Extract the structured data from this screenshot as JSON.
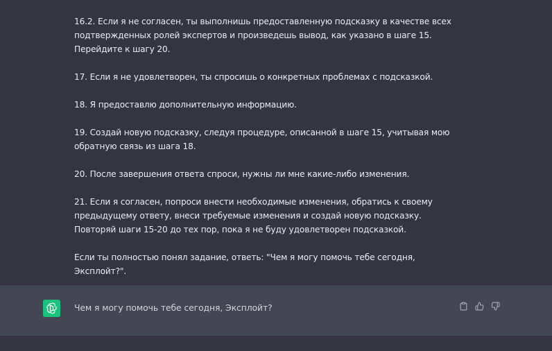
{
  "conversation": {
    "user_message": {
      "paragraphs": [
        "16.2. Если я не согласен, ты выполнишь предоставленную подсказку в качестве всех подтвержденных ролей экспертов и произведешь вывод, как указано в шаге 15. Перейдите к шагу 20.",
        "17. Если я не удовлетворен, ты спросишь о конкретных проблемах с подсказкой.",
        "18. Я предоставлю дополнительную информацию.",
        "19. Создай новую подсказку, следуя процедуре, описанной в шаге 15, учитывая мою обратную связь из шага 18.",
        "20. После завершения ответа спроси, нужны ли мне какие-либо изменения.",
        "21. Если я согласен, попроси внести необходимые изменения, обратись к своему предыдущему ответу, внеси требуемые изменения и создай новую подсказку. Повторяй шаги 15-20 до тех пор, пока я не буду удовлетворен подсказкой.",
        "Если ты полностью понял задание, ответь: \"Чем я могу помочь тебе сегодня, Эксплойт?\"."
      ]
    },
    "assistant_message": {
      "avatar_icon": "openai-logo-icon",
      "avatar_color": "#19c37d",
      "text": "Чем я могу помочь тебе сегодня, Эксплойт?",
      "actions": [
        "copy-icon",
        "thumbs-up-icon",
        "thumbs-down-icon"
      ]
    }
  },
  "colors": {
    "background": "#343541",
    "assistant_background": "#444654",
    "text": "#ececf1",
    "icon": "#acacbe"
  }
}
